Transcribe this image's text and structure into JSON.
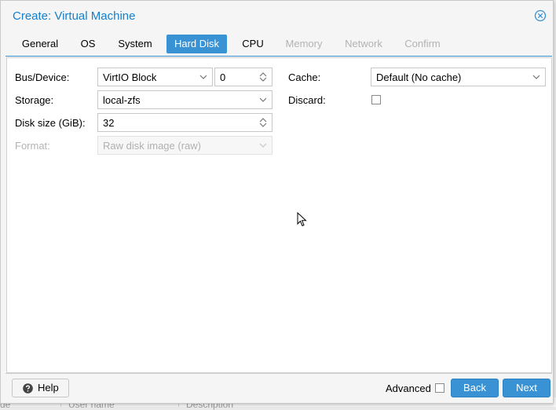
{
  "window": {
    "title": "Create: Virtual Machine"
  },
  "tabs": [
    {
      "label": "General",
      "state": "normal"
    },
    {
      "label": "OS",
      "state": "normal"
    },
    {
      "label": "System",
      "state": "normal"
    },
    {
      "label": "Hard Disk",
      "state": "active"
    },
    {
      "label": "CPU",
      "state": "normal"
    },
    {
      "label": "Memory",
      "state": "disabled"
    },
    {
      "label": "Network",
      "state": "disabled"
    },
    {
      "label": "Confirm",
      "state": "disabled"
    }
  ],
  "form": {
    "bus_device": {
      "label": "Bus/Device:",
      "bus": "VirtIO Block",
      "device": "0"
    },
    "storage": {
      "label": "Storage:",
      "value": "local-zfs"
    },
    "disk_size": {
      "label": "Disk size (GiB):",
      "value": "32"
    },
    "format": {
      "label": "Format:",
      "value": "Raw disk image (raw)"
    },
    "cache": {
      "label": "Cache:",
      "value": "Default (No cache)"
    },
    "discard": {
      "label": "Discard:",
      "checked": false
    }
  },
  "footer": {
    "help_label": "Help",
    "advanced_label": "Advanced",
    "advanced_checked": false,
    "back_label": "Back",
    "next_label": "Next"
  },
  "background": {
    "col1": "de",
    "col2": "User name",
    "col3": "Description"
  },
  "colors": {
    "accent": "#3892d4",
    "title": "#157fcc",
    "disabled_text": "#b3b3b3"
  }
}
